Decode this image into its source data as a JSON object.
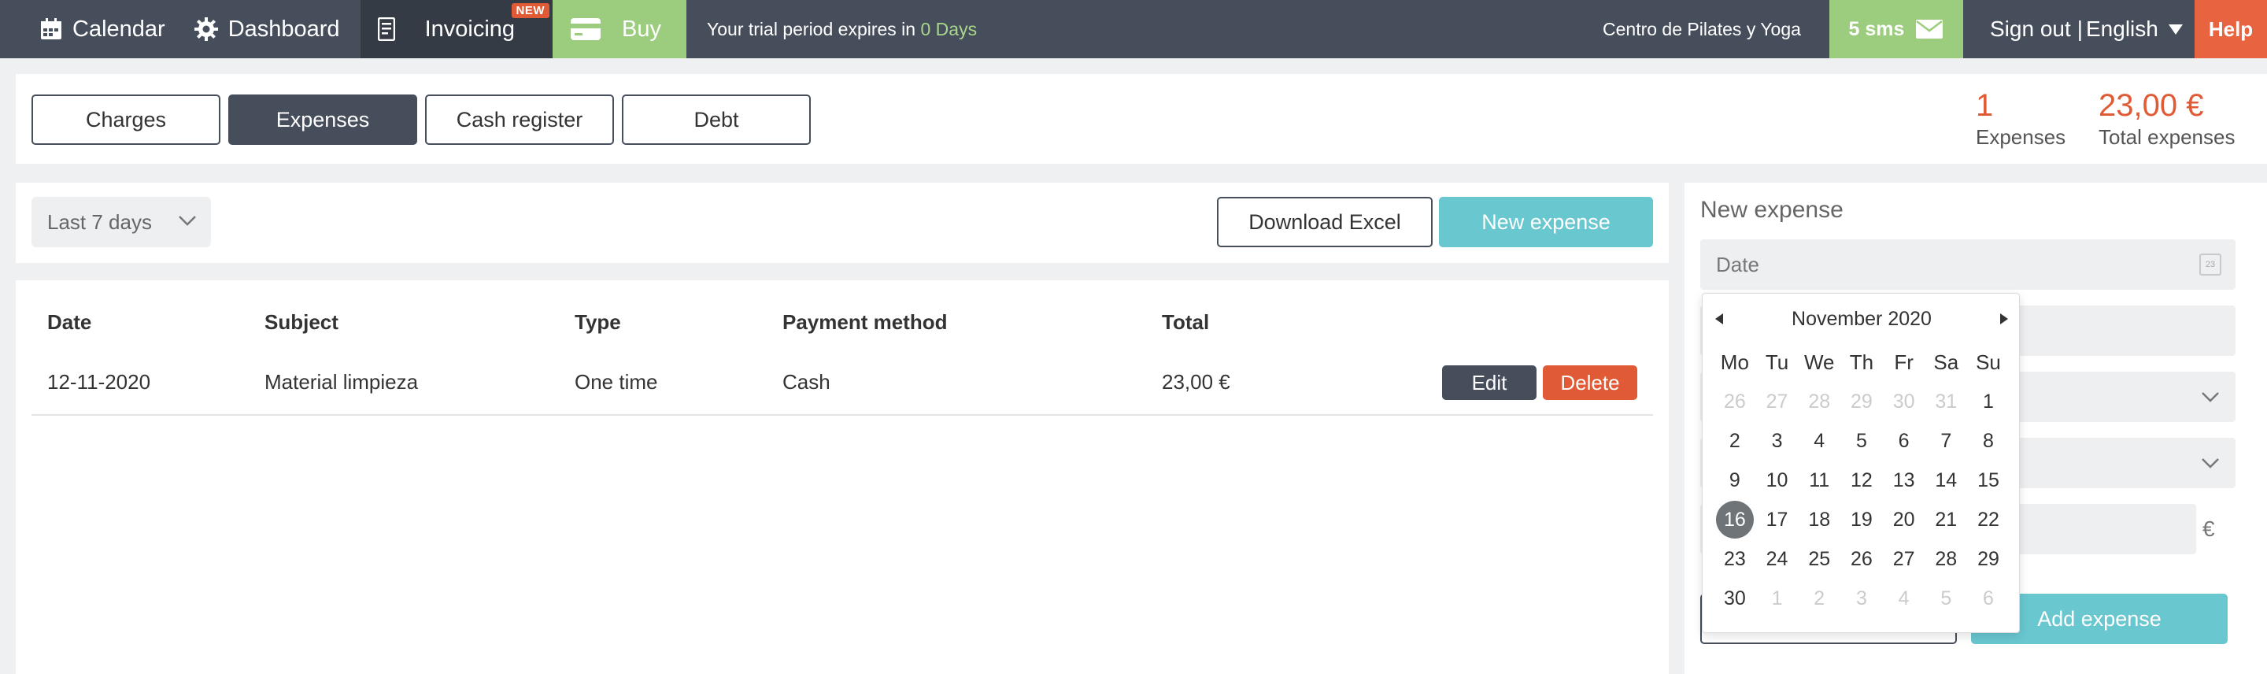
{
  "nav": {
    "calendar": "Calendar",
    "dashboard": "Dashboard",
    "invoicing": "Invoicing",
    "new_badge": "NEW",
    "buy": "Buy",
    "trial_text": "Your trial period expires in ",
    "trial_days": "0 Days",
    "center_name": "Centro de Pilates y Yoga",
    "sms": "5 sms",
    "sign_out": "Sign out",
    "separator": "|",
    "language": "English",
    "help": "Help"
  },
  "tabs": [
    {
      "label": "Charges",
      "active": false
    },
    {
      "label": "Expenses",
      "active": true
    },
    {
      "label": "Cash register",
      "active": false
    },
    {
      "label": "Debt",
      "active": false
    }
  ],
  "stats": {
    "expenses_count": "1",
    "expenses_label": "Expenses",
    "total_value": "23,00 €",
    "total_label": "Total expenses"
  },
  "filter": {
    "period": "Last 7 days",
    "download_excel": "Download Excel",
    "new_expense": "New expense"
  },
  "table": {
    "headers": [
      "Date",
      "Subject",
      "Type",
      "Payment method",
      "Total"
    ],
    "rows": [
      {
        "date": "12-11-2020",
        "subject": "Material limpieza",
        "type": "One time",
        "payment": "Cash",
        "total": "23,00 €"
      }
    ],
    "edit": "Edit",
    "delete": "Delete"
  },
  "panel": {
    "title": "New expense",
    "date_placeholder": "Date",
    "calendar_icon_text": "23",
    "currency": "€",
    "add_expense": "Add expense"
  },
  "datepicker": {
    "month": "November 2020",
    "weekdays": [
      "Mo",
      "Tu",
      "We",
      "Th",
      "Fr",
      "Sa",
      "Su"
    ],
    "weeks": [
      [
        [
          "26",
          0
        ],
        [
          "27",
          0
        ],
        [
          "28",
          0
        ],
        [
          "29",
          0
        ],
        [
          "30",
          0
        ],
        [
          "31",
          0
        ],
        [
          "1",
          1
        ]
      ],
      [
        [
          "2",
          1
        ],
        [
          "3",
          1
        ],
        [
          "4",
          1
        ],
        [
          "5",
          1
        ],
        [
          "6",
          1
        ],
        [
          "7",
          1
        ],
        [
          "8",
          1
        ]
      ],
      [
        [
          "9",
          1
        ],
        [
          "10",
          1
        ],
        [
          "11",
          1
        ],
        [
          "12",
          1
        ],
        [
          "13",
          1
        ],
        [
          "14",
          1
        ],
        [
          "15",
          1
        ]
      ],
      [
        [
          "16",
          2
        ],
        [
          "17",
          1
        ],
        [
          "18",
          1
        ],
        [
          "19",
          1
        ],
        [
          "20",
          1
        ],
        [
          "21",
          1
        ],
        [
          "22",
          1
        ]
      ],
      [
        [
          "23",
          1
        ],
        [
          "24",
          1
        ],
        [
          "25",
          1
        ],
        [
          "26",
          1
        ],
        [
          "27",
          1
        ],
        [
          "28",
          1
        ],
        [
          "29",
          1
        ]
      ],
      [
        [
          "30",
          1
        ],
        [
          "1",
          0
        ],
        [
          "2",
          0
        ],
        [
          "3",
          0
        ],
        [
          "4",
          0
        ],
        [
          "5",
          0
        ],
        [
          "6",
          0
        ]
      ]
    ]
  },
  "colors": {
    "nav_bg": "#464e5b",
    "accent_green": "#9ccc7d",
    "accent_teal": "#69c7d0",
    "accent_orange": "#e05b35"
  }
}
